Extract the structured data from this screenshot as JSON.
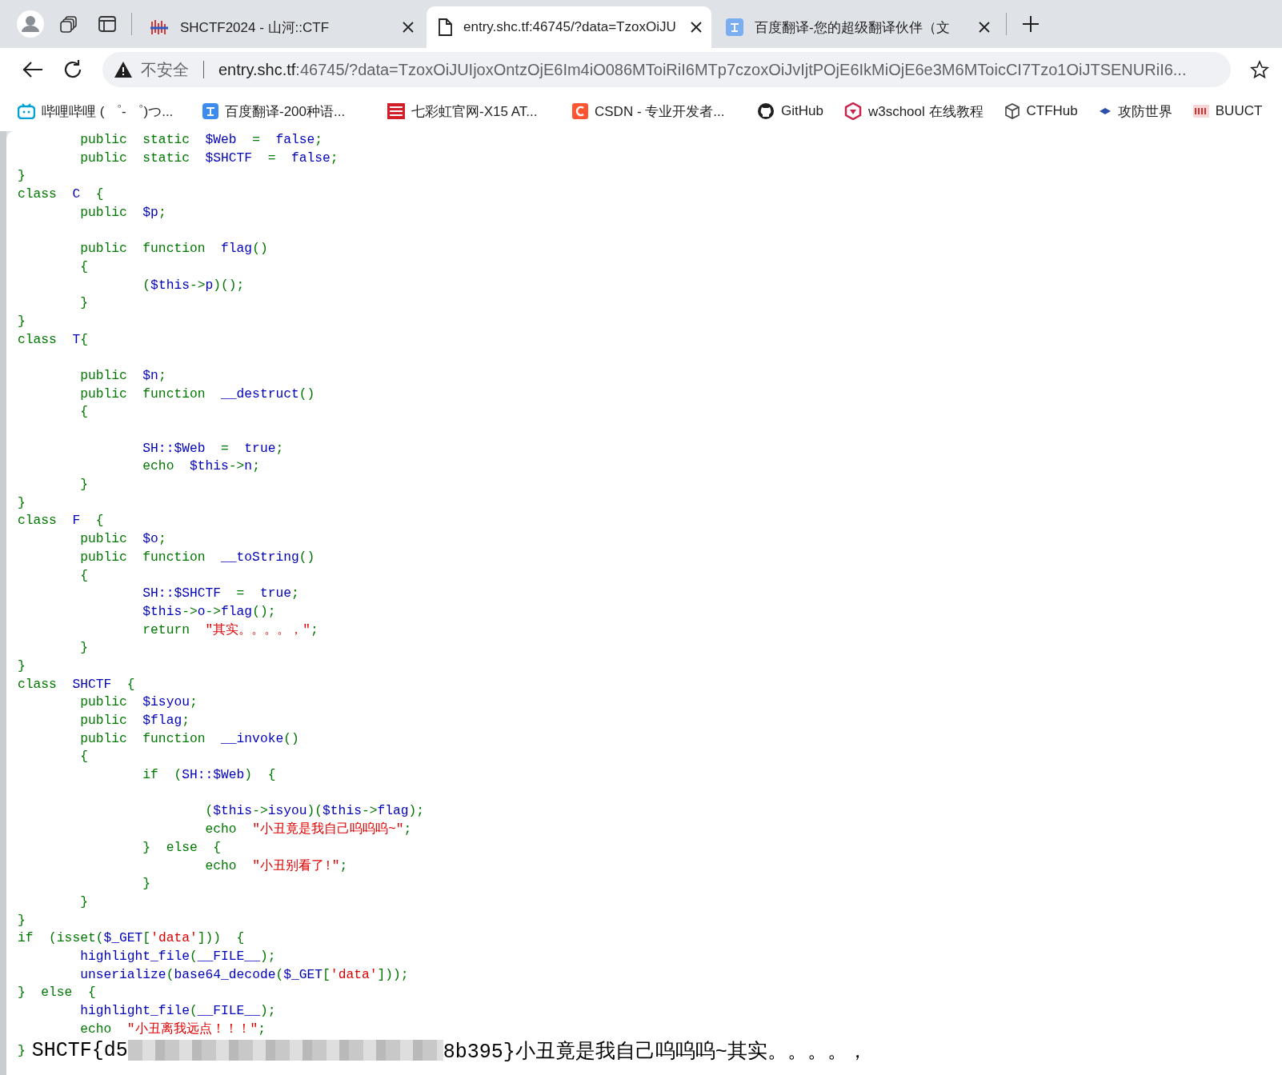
{
  "tabs": [
    {
      "title": "SHCTF2024 - 山河::CTF",
      "selected": false
    },
    {
      "title": "entry.shc.tf:46745/?data=TzoxOiJU",
      "selected": true
    },
    {
      "title": "百度翻译-您的超级翻译伙伴（文",
      "selected": false
    }
  ],
  "address_bar": {
    "security": "不安全",
    "host": "entry.shc.tf",
    "rest": ":46745/?data=TzoxOiJUIjoxOntzOjE6Im4iO086MToiRiI6MTp7czoxOiJvIjtPOjE6IkMiOjE6e3M6MToicCI7Tzo1OiJTSENURiI6..."
  },
  "bookmarks": [
    "哔哩哔哩 ( ゜- ゜)つ...",
    "百度翻译-200种语...",
    "七彩虹官网-X15 AT...",
    "CSDN - 专业开发者...",
    "GitHub",
    "w3school 在线教程",
    "CTFHub",
    "攻防世界",
    "BUUCT"
  ],
  "code_lines": [
    {
      "kind": "code",
      "tokens": [
        {
          "kind": "keyword",
          "text": "        public  static  "
        },
        {
          "kind": "default",
          "text": "$Web  "
        },
        {
          "kind": "keyword",
          "text": "=  "
        },
        {
          "kind": "default",
          "text": "false"
        },
        {
          "kind": "keyword",
          "text": ";"
        }
      ]
    },
    {
      "kind": "code",
      "tokens": [
        {
          "kind": "keyword",
          "text": "        public  static  "
        },
        {
          "kind": "default",
          "text": "$SHCTF  "
        },
        {
          "kind": "keyword",
          "text": "=  "
        },
        {
          "kind": "default",
          "text": "false"
        },
        {
          "kind": "keyword",
          "text": ";"
        }
      ]
    },
    {
      "kind": "code",
      "tokens": [
        {
          "kind": "keyword",
          "text": "}"
        }
      ]
    },
    {
      "kind": "code",
      "tokens": [
        {
          "kind": "keyword",
          "text": "class  "
        },
        {
          "kind": "default",
          "text": "C  "
        },
        {
          "kind": "keyword",
          "text": "{"
        }
      ]
    },
    {
      "kind": "code",
      "tokens": [
        {
          "kind": "keyword",
          "text": "        public  "
        },
        {
          "kind": "default",
          "text": "$p"
        },
        {
          "kind": "keyword",
          "text": ";"
        }
      ]
    },
    {
      "kind": "blank"
    },
    {
      "kind": "code",
      "tokens": [
        {
          "kind": "keyword",
          "text": "        public  function  "
        },
        {
          "kind": "default",
          "text": "flag"
        },
        {
          "kind": "keyword",
          "text": "()"
        }
      ]
    },
    {
      "kind": "code",
      "tokens": [
        {
          "kind": "keyword",
          "text": "        {"
        }
      ]
    },
    {
      "kind": "code",
      "tokens": [
        {
          "kind": "keyword",
          "text": "                ("
        },
        {
          "kind": "default",
          "text": "$this"
        },
        {
          "kind": "keyword",
          "text": "->"
        },
        {
          "kind": "default",
          "text": "p"
        },
        {
          "kind": "keyword",
          "text": ")();"
        }
      ]
    },
    {
      "kind": "code",
      "tokens": [
        {
          "kind": "keyword",
          "text": "        }"
        }
      ]
    },
    {
      "kind": "code",
      "tokens": [
        {
          "kind": "keyword",
          "text": "}"
        }
      ]
    },
    {
      "kind": "code",
      "tokens": [
        {
          "kind": "keyword",
          "text": "class  "
        },
        {
          "kind": "default",
          "text": "T"
        },
        {
          "kind": "keyword",
          "text": "{"
        }
      ]
    },
    {
      "kind": "blank"
    },
    {
      "kind": "code",
      "tokens": [
        {
          "kind": "keyword",
          "text": "        public  "
        },
        {
          "kind": "default",
          "text": "$n"
        },
        {
          "kind": "keyword",
          "text": ";"
        }
      ]
    },
    {
      "kind": "code",
      "tokens": [
        {
          "kind": "keyword",
          "text": "        public  function  "
        },
        {
          "kind": "default",
          "text": "__destruct"
        },
        {
          "kind": "keyword",
          "text": "()"
        }
      ]
    },
    {
      "kind": "code",
      "tokens": [
        {
          "kind": "keyword",
          "text": "        {"
        }
      ]
    },
    {
      "kind": "blank"
    },
    {
      "kind": "code",
      "tokens": [
        {
          "kind": "default",
          "text": "                SH::$Web  "
        },
        {
          "kind": "keyword",
          "text": "=  "
        },
        {
          "kind": "default",
          "text": "true"
        },
        {
          "kind": "keyword",
          "text": ";"
        }
      ]
    },
    {
      "kind": "code",
      "tokens": [
        {
          "kind": "keyword",
          "text": "                echo  "
        },
        {
          "kind": "default",
          "text": "$this"
        },
        {
          "kind": "keyword",
          "text": "->"
        },
        {
          "kind": "default",
          "text": "n"
        },
        {
          "kind": "keyword",
          "text": ";"
        }
      ]
    },
    {
      "kind": "code",
      "tokens": [
        {
          "kind": "keyword",
          "text": "        }"
        }
      ]
    },
    {
      "kind": "code",
      "tokens": [
        {
          "kind": "keyword",
          "text": "}"
        }
      ]
    },
    {
      "kind": "code",
      "tokens": [
        {
          "kind": "keyword",
          "text": "class  "
        },
        {
          "kind": "default",
          "text": "F  "
        },
        {
          "kind": "keyword",
          "text": "{"
        }
      ]
    },
    {
      "kind": "code",
      "tokens": [
        {
          "kind": "keyword",
          "text": "        public  "
        },
        {
          "kind": "default",
          "text": "$o"
        },
        {
          "kind": "keyword",
          "text": ";"
        }
      ]
    },
    {
      "kind": "code",
      "tokens": [
        {
          "kind": "keyword",
          "text": "        public  function  "
        },
        {
          "kind": "default",
          "text": "__toString"
        },
        {
          "kind": "keyword",
          "text": "()"
        }
      ]
    },
    {
      "kind": "code",
      "tokens": [
        {
          "kind": "keyword",
          "text": "        {"
        }
      ]
    },
    {
      "kind": "code",
      "tokens": [
        {
          "kind": "default",
          "text": "                SH::$SHCTF  "
        },
        {
          "kind": "keyword",
          "text": "=  "
        },
        {
          "kind": "default",
          "text": "true"
        },
        {
          "kind": "keyword",
          "text": ";"
        }
      ]
    },
    {
      "kind": "code",
      "tokens": [
        {
          "kind": "default",
          "text": "                $this"
        },
        {
          "kind": "keyword",
          "text": "->"
        },
        {
          "kind": "default",
          "text": "o"
        },
        {
          "kind": "keyword",
          "text": "->"
        },
        {
          "kind": "default",
          "text": "flag"
        },
        {
          "kind": "keyword",
          "text": "();"
        }
      ]
    },
    {
      "kind": "code",
      "tokens": [
        {
          "kind": "keyword",
          "text": "                return  "
        },
        {
          "kind": "string",
          "text": "\"其实。。。。，\""
        },
        {
          "kind": "keyword",
          "text": ";"
        }
      ]
    },
    {
      "kind": "code",
      "tokens": [
        {
          "kind": "keyword",
          "text": "        }"
        }
      ]
    },
    {
      "kind": "code",
      "tokens": [
        {
          "kind": "keyword",
          "text": "}"
        }
      ]
    },
    {
      "kind": "code",
      "tokens": [
        {
          "kind": "keyword",
          "text": "class  "
        },
        {
          "kind": "default",
          "text": "SHCTF  "
        },
        {
          "kind": "keyword",
          "text": "{"
        }
      ]
    },
    {
      "kind": "code",
      "tokens": [
        {
          "kind": "keyword",
          "text": "        public  "
        },
        {
          "kind": "default",
          "text": "$isyou"
        },
        {
          "kind": "keyword",
          "text": ";"
        }
      ]
    },
    {
      "kind": "code",
      "tokens": [
        {
          "kind": "keyword",
          "text": "        public  "
        },
        {
          "kind": "default",
          "text": "$flag"
        },
        {
          "kind": "keyword",
          "text": ";"
        }
      ]
    },
    {
      "kind": "code",
      "tokens": [
        {
          "kind": "keyword",
          "text": "        public  function  "
        },
        {
          "kind": "default",
          "text": "__invoke"
        },
        {
          "kind": "keyword",
          "text": "()"
        }
      ]
    },
    {
      "kind": "code",
      "tokens": [
        {
          "kind": "keyword",
          "text": "        {"
        }
      ]
    },
    {
      "kind": "code",
      "tokens": [
        {
          "kind": "keyword",
          "text": "                if  ("
        },
        {
          "kind": "default",
          "text": "SH::$Web"
        },
        {
          "kind": "keyword",
          "text": ")  {"
        }
      ]
    },
    {
      "kind": "blank"
    },
    {
      "kind": "code",
      "tokens": [
        {
          "kind": "keyword",
          "text": "                        ("
        },
        {
          "kind": "default",
          "text": "$this"
        },
        {
          "kind": "keyword",
          "text": "->"
        },
        {
          "kind": "default",
          "text": "isyou"
        },
        {
          "kind": "keyword",
          "text": ")("
        },
        {
          "kind": "default",
          "text": "$this"
        },
        {
          "kind": "keyword",
          "text": "->"
        },
        {
          "kind": "default",
          "text": "flag"
        },
        {
          "kind": "keyword",
          "text": ");"
        }
      ]
    },
    {
      "kind": "code",
      "tokens": [
        {
          "kind": "keyword",
          "text": "                        echo  "
        },
        {
          "kind": "string",
          "text": "\"小丑竟是我自己呜呜呜~\""
        },
        {
          "kind": "keyword",
          "text": ";"
        }
      ]
    },
    {
      "kind": "code",
      "tokens": [
        {
          "kind": "keyword",
          "text": "                }  else  {"
        }
      ]
    },
    {
      "kind": "code",
      "tokens": [
        {
          "kind": "keyword",
          "text": "                        echo  "
        },
        {
          "kind": "string",
          "text": "\"小丑别看了!\""
        },
        {
          "kind": "keyword",
          "text": ";"
        }
      ]
    },
    {
      "kind": "code",
      "tokens": [
        {
          "kind": "keyword",
          "text": "                }"
        }
      ]
    },
    {
      "kind": "code",
      "tokens": [
        {
          "kind": "keyword",
          "text": "        }"
        }
      ]
    },
    {
      "kind": "code",
      "tokens": [
        {
          "kind": "keyword",
          "text": "}"
        }
      ]
    },
    {
      "kind": "code",
      "tokens": [
        {
          "kind": "keyword",
          "text": "if  (isset("
        },
        {
          "kind": "default",
          "text": "$_GET"
        },
        {
          "kind": "keyword",
          "text": "["
        },
        {
          "kind": "string",
          "text": "'data'"
        },
        {
          "kind": "keyword",
          "text": "]))  {"
        }
      ]
    },
    {
      "kind": "code",
      "tokens": [
        {
          "kind": "default",
          "text": "        highlight_file"
        },
        {
          "kind": "keyword",
          "text": "("
        },
        {
          "kind": "default",
          "text": "__FILE__"
        },
        {
          "kind": "keyword",
          "text": ");"
        }
      ]
    },
    {
      "kind": "code",
      "tokens": [
        {
          "kind": "default",
          "text": "        unserialize"
        },
        {
          "kind": "keyword",
          "text": "("
        },
        {
          "kind": "default",
          "text": "base64_decode"
        },
        {
          "kind": "keyword",
          "text": "("
        },
        {
          "kind": "default",
          "text": "$_GET"
        },
        {
          "kind": "keyword",
          "text": "["
        },
        {
          "kind": "string",
          "text": "'data'"
        },
        {
          "kind": "keyword",
          "text": "]));"
        }
      ]
    },
    {
      "kind": "code",
      "tokens": [
        {
          "kind": "keyword",
          "text": "}  else  {"
        }
      ]
    },
    {
      "kind": "code",
      "tokens": [
        {
          "kind": "default",
          "text": "        highlight_file"
        },
        {
          "kind": "keyword",
          "text": "("
        },
        {
          "kind": "default",
          "text": "__FILE__"
        },
        {
          "kind": "keyword",
          "text": ");"
        }
      ]
    },
    {
      "kind": "code",
      "tokens": [
        {
          "kind": "keyword",
          "text": "        echo  "
        },
        {
          "kind": "string",
          "text": "\"小丑离我远点！！！\""
        },
        {
          "kind": "keyword",
          "text": ";"
        }
      ]
    }
  ],
  "last_line": {
    "brace": "}",
    "output_start": "SHCTF{d5",
    "output_end": "8b395}小丑竟是我自己呜呜呜~其实。。。。，"
  }
}
